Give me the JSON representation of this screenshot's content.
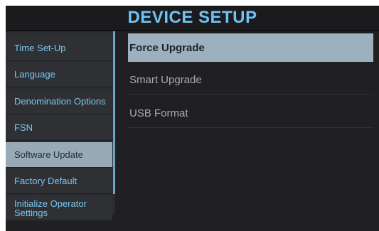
{
  "header": {
    "title": "DEVICE SETUP"
  },
  "sidebar": {
    "items": [
      {
        "label": "Time Set-Up",
        "active": false
      },
      {
        "label": "Language",
        "active": false
      },
      {
        "label": "Denomination Options",
        "active": false
      },
      {
        "label": "FSN",
        "active": false
      },
      {
        "label": "Software Update",
        "active": true
      },
      {
        "label": "Factory Default",
        "active": false
      },
      {
        "label": "Initialize Operator Settings",
        "active": false
      }
    ]
  },
  "main": {
    "options": [
      {
        "label": "Force Upgrade",
        "selected": true
      },
      {
        "label": "Smart Upgrade",
        "selected": false
      },
      {
        "label": "USB Format",
        "selected": false
      }
    ]
  },
  "colors": {
    "accent": "#6ec3f4",
    "active_background": "#98aab6",
    "panel_background": "#202022"
  }
}
